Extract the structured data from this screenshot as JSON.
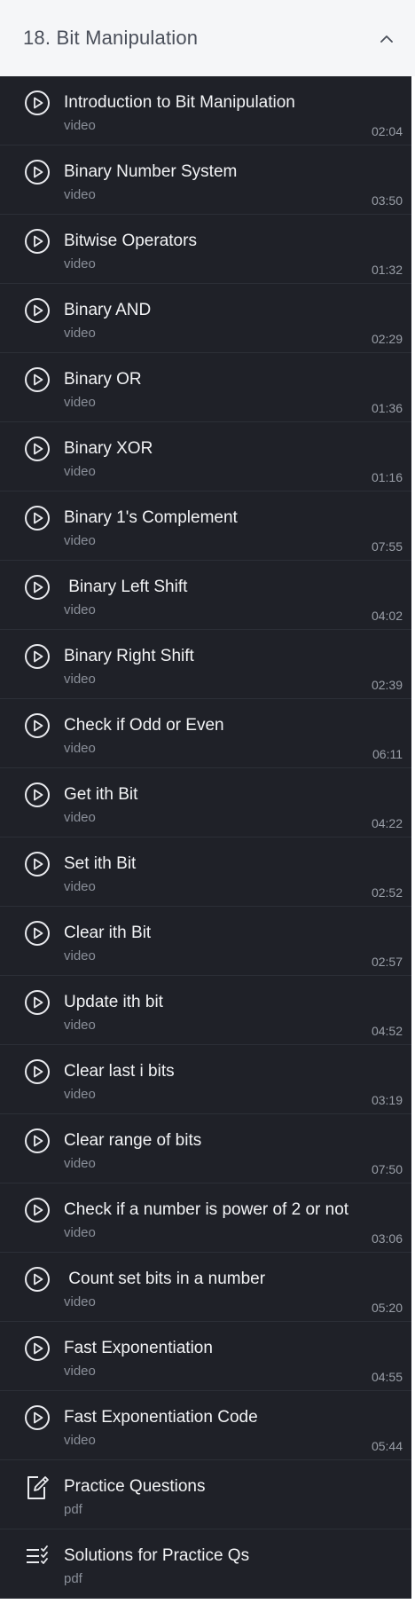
{
  "section": {
    "title": "18. Bit Manipulation",
    "chevron_icon": "chevron-up-icon"
  },
  "items": [
    {
      "title": "Introduction to Bit Manipulation",
      "type": "video",
      "duration": "02:04",
      "icon": "play-circle-icon"
    },
    {
      "title": "Binary Number System",
      "type": "video",
      "duration": "03:50",
      "icon": "play-circle-icon"
    },
    {
      "title": "Bitwise Operators",
      "type": "video",
      "duration": "01:32",
      "icon": "play-circle-icon"
    },
    {
      "title": "Binary AND",
      "type": "video",
      "duration": "02:29",
      "icon": "play-circle-icon"
    },
    {
      "title": "Binary OR",
      "type": "video",
      "duration": "01:36",
      "icon": "play-circle-icon"
    },
    {
      "title": "Binary XOR",
      "type": "video",
      "duration": "01:16",
      "icon": "play-circle-icon"
    },
    {
      "title": "Binary 1's Complement",
      "type": "video",
      "duration": "07:55",
      "icon": "play-circle-icon"
    },
    {
      "title": " Binary Left Shift",
      "type": "video",
      "duration": "04:02",
      "icon": "play-circle-icon"
    },
    {
      "title": "Binary Right Shift",
      "type": "video",
      "duration": "02:39",
      "icon": "play-circle-icon"
    },
    {
      "title": "Check if Odd or Even",
      "type": "video",
      "duration": "06:11",
      "icon": "play-circle-icon"
    },
    {
      "title": "Get ith Bit",
      "type": "video",
      "duration": "04:22",
      "icon": "play-circle-icon"
    },
    {
      "title": "Set ith Bit",
      "type": "video",
      "duration": "02:52",
      "icon": "play-circle-icon"
    },
    {
      "title": "Clear ith Bit",
      "type": "video",
      "duration": "02:57",
      "icon": "play-circle-icon"
    },
    {
      "title": "Update ith bit",
      "type": "video",
      "duration": "04:52",
      "icon": "play-circle-icon"
    },
    {
      "title": "Clear last i bits",
      "type": "video",
      "duration": "03:19",
      "icon": "play-circle-icon"
    },
    {
      "title": "Clear range of bits",
      "type": "video",
      "duration": "07:50",
      "icon": "play-circle-icon"
    },
    {
      "title": "Check if a number is power of 2 or not",
      "type": "video",
      "duration": "03:06",
      "icon": "play-circle-icon"
    },
    {
      "title": " Count set bits in a number",
      "type": "video",
      "duration": "05:20",
      "icon": "play-circle-icon"
    },
    {
      "title": "Fast Exponentiation",
      "type": "video",
      "duration": "04:55",
      "icon": "play-circle-icon"
    },
    {
      "title": "Fast Exponentiation Code",
      "type": "video",
      "duration": "05:44",
      "icon": "play-circle-icon"
    },
    {
      "title": "Practice Questions",
      "type": "pdf",
      "duration": "",
      "icon": "edit-document-icon"
    },
    {
      "title": "Solutions for Practice Qs",
      "type": "pdf",
      "duration": "",
      "icon": "checklist-icon"
    }
  ]
}
